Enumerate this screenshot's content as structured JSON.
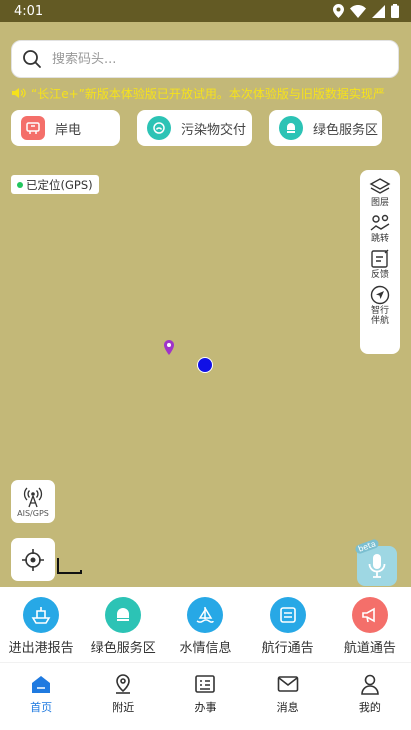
{
  "status_bar": {
    "time": "4:01"
  },
  "search": {
    "placeholder": "搜索码头..."
  },
  "notice": {
    "text": "“长江e+”新版本体验版已开放试用。本次体验版与旧版数据实现严"
  },
  "quick_buttons": [
    {
      "label": "岸电",
      "icon": "shore-power-icon",
      "color": "#f46f6a"
    },
    {
      "label": "污染物交付",
      "icon": "pollutant-icon",
      "color": "#2cc3b5"
    },
    {
      "label": "绿色服务区",
      "icon": "green-service-icon",
      "color": "#2cc3b5"
    }
  ],
  "map": {
    "location_status": "已定位(GPS)",
    "tools": [
      {
        "label": "图层",
        "icon": "layers-icon"
      },
      {
        "label": "跳转",
        "icon": "map-jump-icon"
      },
      {
        "label": "反馈",
        "icon": "feedback-icon"
      },
      {
        "label": "智行伴航",
        "icon": "navigation-icon"
      }
    ],
    "ais_label": "AIS/GPS",
    "voice_badge": "beta"
  },
  "services": [
    {
      "label": "进出港报告",
      "icon": "port-report-icon",
      "color": "#27a8e6"
    },
    {
      "label": "绿色服务区",
      "icon": "green-service-icon",
      "color": "#2cc3b5"
    },
    {
      "label": "水情信息",
      "icon": "water-info-icon",
      "color": "#27a8e6"
    },
    {
      "label": "航行通告",
      "icon": "notice-icon",
      "color": "#27a8e6"
    },
    {
      "label": "航道通告",
      "icon": "channel-notice-icon",
      "color": "#f46f6a"
    }
  ],
  "nav": [
    {
      "label": "首页",
      "icon": "home-icon",
      "active": true
    },
    {
      "label": "附近",
      "icon": "nearby-icon",
      "active": false
    },
    {
      "label": "办事",
      "icon": "affairs-icon",
      "active": false
    },
    {
      "label": "消息",
      "icon": "message-icon",
      "active": false
    },
    {
      "label": "我的",
      "icon": "profile-icon",
      "active": false
    }
  ],
  "colors": {
    "map_bg": "#c3b878",
    "accent": "#1f7ae0",
    "notice_text": "#f6e21b",
    "status_bar": "#635a24"
  }
}
